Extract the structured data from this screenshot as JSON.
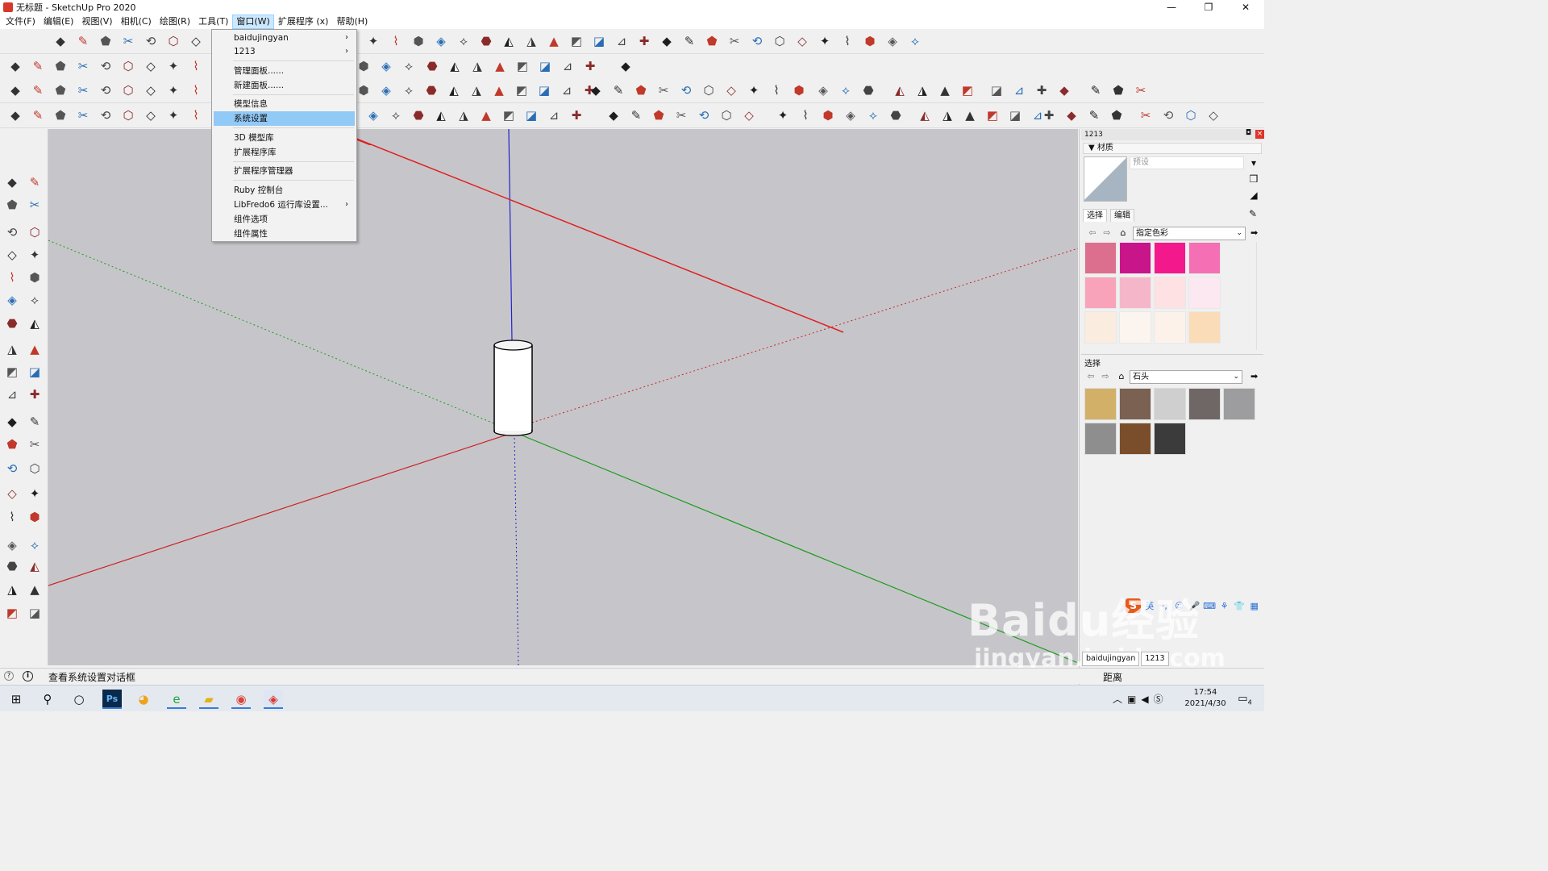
{
  "window": {
    "title": "无标题 - SketchUp Pro 2020",
    "controls": {
      "minimize": "—",
      "maximize": "❐",
      "close": "✕"
    }
  },
  "menubar": {
    "items": [
      {
        "label": "文件(F)"
      },
      {
        "label": "编辑(E)"
      },
      {
        "label": "视图(V)"
      },
      {
        "label": "相机(C)"
      },
      {
        "label": "绘图(R)"
      },
      {
        "label": "工具(T)"
      },
      {
        "label": "窗口(W)",
        "active": true
      },
      {
        "label": "扩展程序 (x)"
      },
      {
        "label": "帮助(H)"
      }
    ]
  },
  "window_menu": {
    "items": [
      {
        "label": "baidujingyan",
        "submenu": true
      },
      {
        "label": "1213",
        "submenu": true
      },
      {
        "label": "管理面板......"
      },
      {
        "label": "新建面板......"
      },
      {
        "label": "模型信息"
      },
      {
        "label": "系统设置",
        "highlighted": true
      },
      {
        "label": "3D 模型库"
      },
      {
        "label": "扩展程序库"
      },
      {
        "label": "扩展程序管理器"
      },
      {
        "label": "Ruby 控制台"
      },
      {
        "label": "LibFredo6 运行库设置...",
        "submenu": true
      },
      {
        "label": "组件选项"
      },
      {
        "label": "组件属性"
      }
    ],
    "submenu_arrow": "›"
  },
  "tray": {
    "title": "1213",
    "pin": "◘",
    "close": "×",
    "materials_panel": {
      "title": "▼ 材质",
      "name_placeholder": "预设",
      "tabs": {
        "select": "选择",
        "edit": "编辑"
      },
      "library_select": "指定色彩",
      "color_swatches": [
        "#dd6f8e",
        "#c8158a",
        "#f3188b",
        "#f46fb3",
        "#f8a3b9",
        "#f6b6c9",
        "#fde1e3",
        "#fce8f1",
        "#fbece0",
        "#fcf5ef",
        "#fcf2ea",
        "#fbdcb8"
      ],
      "secondary_label": "选择",
      "secondary_select": "石头",
      "texture_swatches": [
        "#d2b068",
        "#7a6152",
        "#cfcfcf",
        "#6f6766",
        "#9d9d9f",
        "#8e8e8e",
        "#7a4e2a",
        "#3b3b3b"
      ]
    },
    "bottom_tabs": [
      "baidujingyan",
      "1213"
    ]
  },
  "ime": {
    "logo": "S",
    "icons": [
      "英",
      "·,",
      "☺",
      "🎤",
      "⌨",
      "⚘",
      "👕",
      "▦"
    ]
  },
  "statusbar": {
    "icon1": "?",
    "icon2": "i",
    "hint": "查看系统设置对话框",
    "measure_label": "距离"
  },
  "watermark": {
    "main": "Baidu经验",
    "sub": "jingyan.baidu.com"
  },
  "taskbar": {
    "time": "17:54",
    "date": "2021/4/30",
    "notification_count": "4"
  },
  "colors": {
    "viewport_bg": "#c6c6ca",
    "menu_highlight": "#91c9f7",
    "red_axis": "#cc2222",
    "green_axis": "#1a9a1a",
    "blue_axis": "#2222cc",
    "annotation_arrow": "#e02020"
  }
}
